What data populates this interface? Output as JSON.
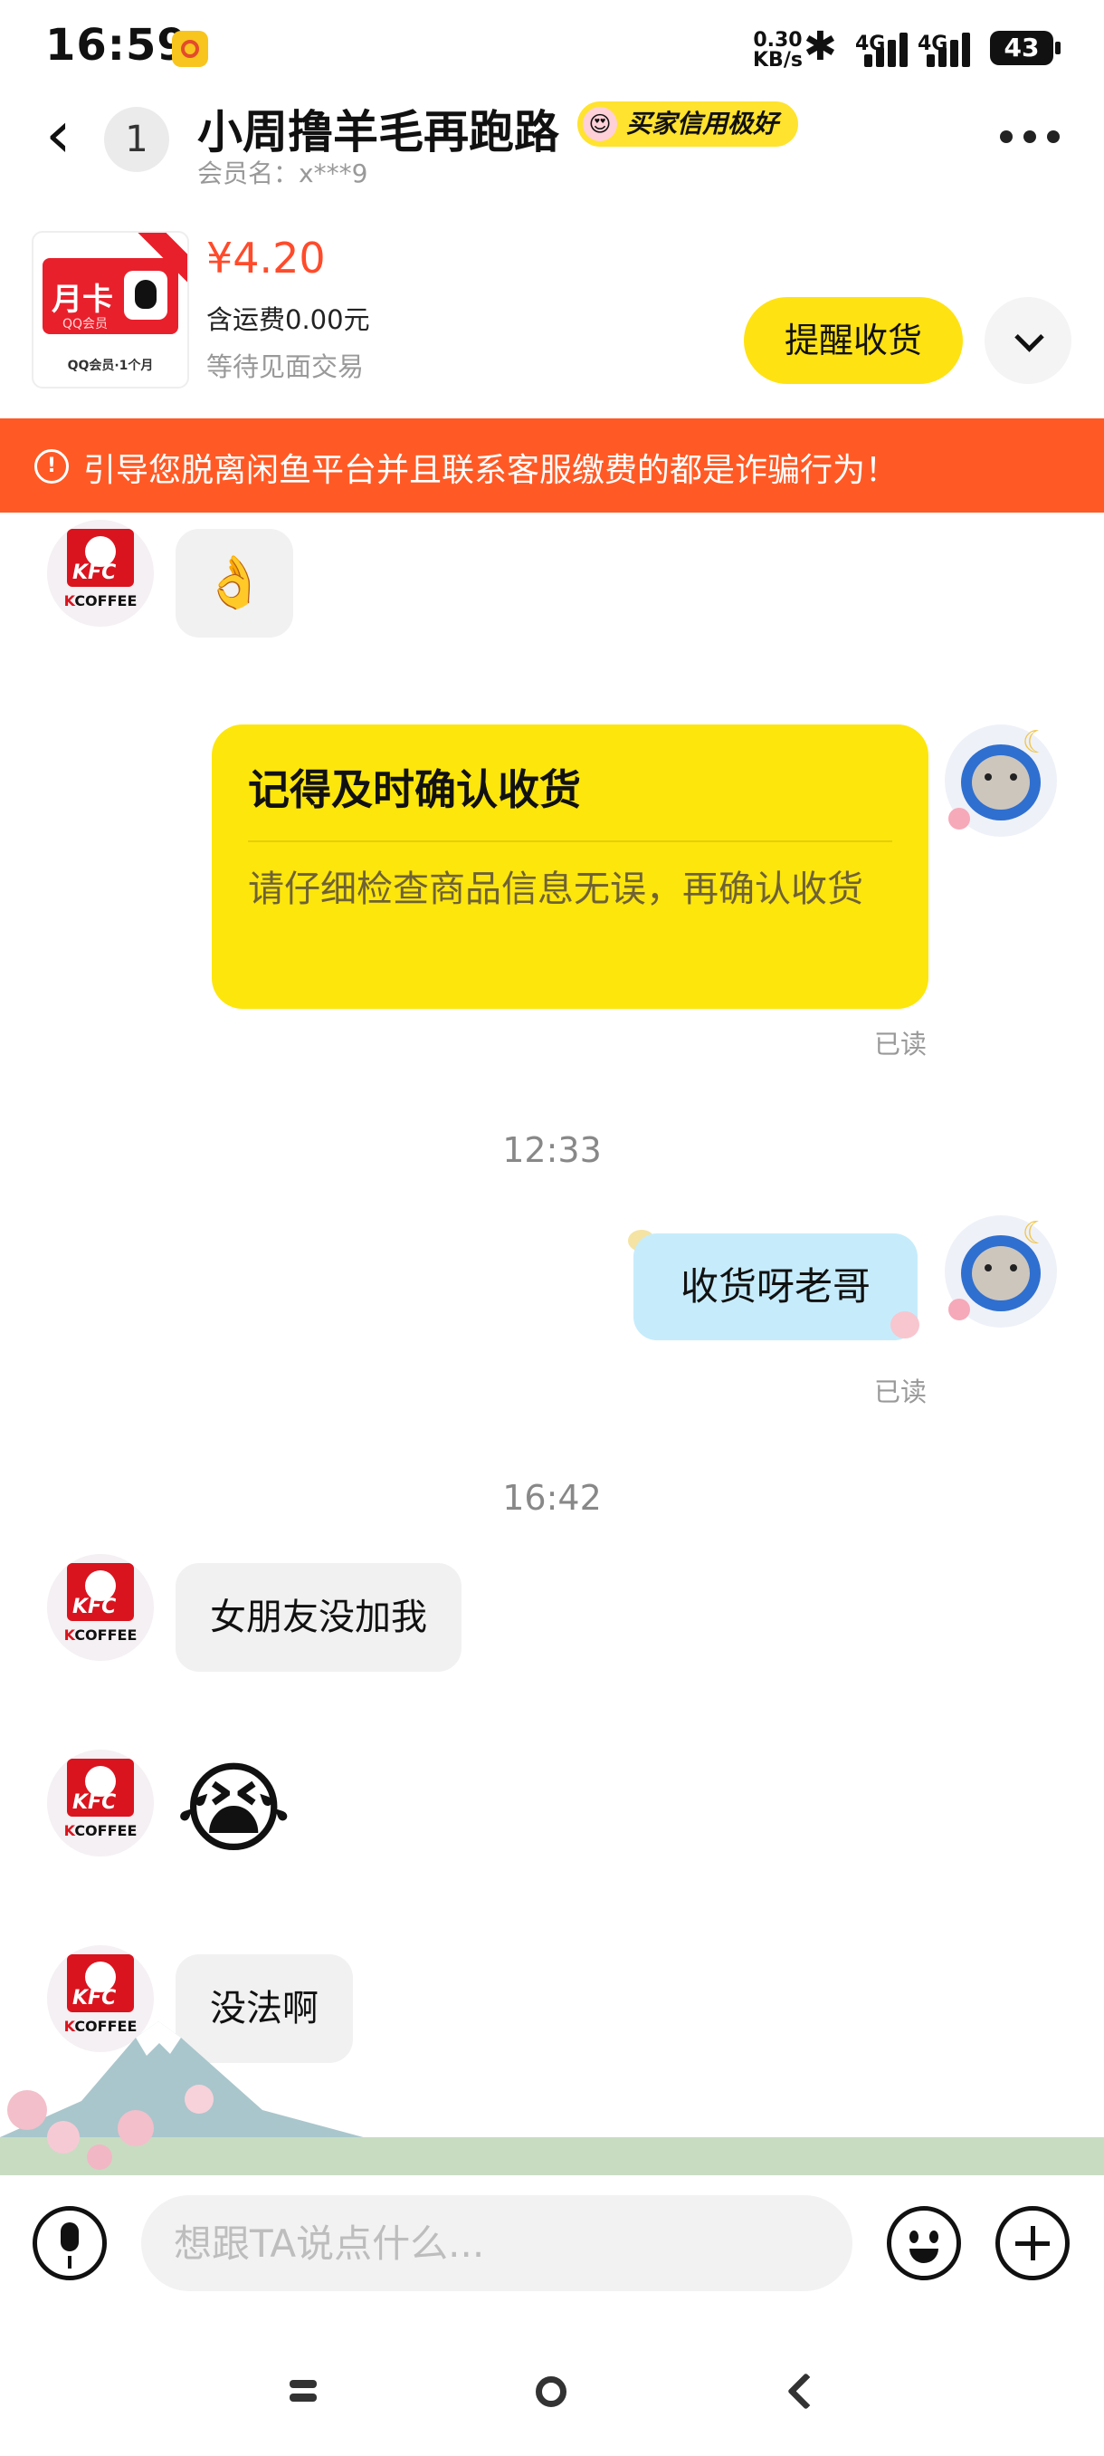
{
  "status_bar": {
    "time": "16:59",
    "net_speed_value": "0.30",
    "net_speed_unit": "KB/s",
    "signal_1": "4G",
    "signal_2": "4G",
    "battery": "43"
  },
  "header": {
    "unread_count": "1",
    "title": "小周撸羊毛再跑路",
    "credit_badge": "买家信用极好",
    "member_label": "会员名：x***9"
  },
  "product": {
    "card_title": "月卡",
    "card_sub": "QQ会员",
    "card_caption": "QQ会员·1个月",
    "price": "¥4.20",
    "shipping": "含运费0.00元",
    "status": "等待见面交易",
    "remind_button": "提醒收货"
  },
  "banner": {
    "text": "引导您脱离闲鱼平台并且联系客服缴费的都是诈骗行为！"
  },
  "chat": {
    "kfc_label": "KCOFFEE",
    "msg_ok": "👌",
    "card_title": "记得及时确认收货",
    "card_body": "请仔细检查商品信息无误，再确认收货",
    "read_1": "已读",
    "time_1": "12:33",
    "msg_right": "收货呀老哥",
    "read_2": "已读",
    "time_2": "16:42",
    "msg_1": "女朋友没加我",
    "msg_2": "😭",
    "msg_3": "没法啊"
  },
  "input_bar": {
    "placeholder": "想跟TA说点什么..."
  },
  "colors": {
    "accent_yellow": "#ffe212",
    "warning_orange": "#ff5a25",
    "price_red": "#ff4b2b",
    "bubble_blue": "#c6ecfb"
  }
}
